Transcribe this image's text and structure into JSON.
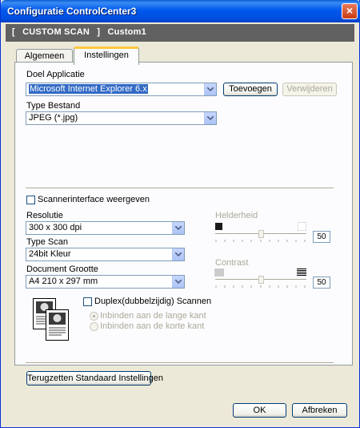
{
  "window": {
    "title": "Configuratie ControlCenter3"
  },
  "header": {
    "left_bracket": "[",
    "name": "CUSTOM SCAN",
    "right_bracket": "]",
    "profile": "Custom1"
  },
  "tabs": [
    {
      "label": "Algemeen",
      "active": false
    },
    {
      "label": "Instellingen",
      "active": true
    }
  ],
  "target_app": {
    "label": "Doel Applicatie",
    "value": "Microsoft Internet Explorer 6.x",
    "add_button": "Toevoegen",
    "remove_button": "Verwijderen"
  },
  "file_type": {
    "label": "Type Bestand",
    "value": "JPEG (*.jpg)"
  },
  "show_scanner_interface": {
    "label": "Scannerinterface weergeven",
    "checked": false
  },
  "resolution": {
    "label": "Resolutie",
    "value": "300 x 300 dpi"
  },
  "scan_type": {
    "label": "Type Scan",
    "value": "24bit Kleur"
  },
  "document_size": {
    "label": "Document Grootte",
    "value": "A4 210 x 297 mm"
  },
  "brightness": {
    "label": "Helderheid",
    "value": "50",
    "level": 0.5
  },
  "contrast": {
    "label": "Contrast",
    "value": "50",
    "level": 0.5
  },
  "duplex": {
    "label": "Duplex(dubbelzijdig) Scannen",
    "checked": false,
    "options": [
      "Inbinden aan de lange kant",
      "Inbinden aan de korte kant"
    ],
    "selected": 0
  },
  "reset_button": "Terugzetten Standaard Instellingen",
  "footer": {
    "ok": "OK",
    "cancel": "Afbreken"
  },
  "colors": {
    "title_bar": "#0054e3",
    "header_bar": "#616161",
    "tab_highlight": "#ffc83c",
    "selection": "#316ac5"
  }
}
